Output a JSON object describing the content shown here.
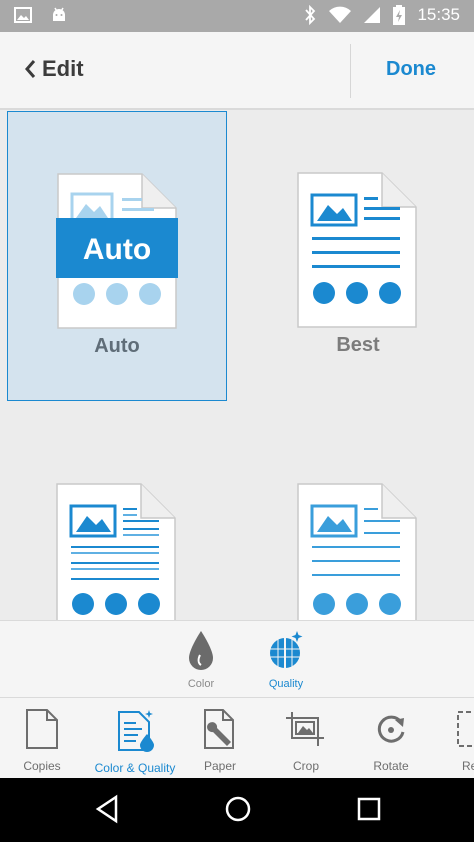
{
  "status_bar": {
    "time": "15:35"
  },
  "app_bar": {
    "back_label": "Edit",
    "done_label": "Done"
  },
  "quality_options": [
    {
      "label": "Auto",
      "badge": "Auto",
      "selected": true
    },
    {
      "label": "Best",
      "selected": false
    },
    {
      "label": "",
      "selected": false
    },
    {
      "label": "",
      "selected": false
    }
  ],
  "mode_tabs": [
    {
      "label": "Color",
      "icon": "droplet-icon",
      "active": false
    },
    {
      "label": "Quality",
      "icon": "quality-icon",
      "active": true
    }
  ],
  "toolbar": {
    "items": [
      {
        "label": "Copies",
        "icon": "copies-icon"
      },
      {
        "label": "Color & Quality",
        "icon": "color-quality-icon",
        "active": true
      },
      {
        "label": "Paper",
        "icon": "paper-icon"
      },
      {
        "label": "Crop",
        "icon": "crop-icon"
      },
      {
        "label": "Rotate",
        "icon": "rotate-icon"
      },
      {
        "label": "Re",
        "icon": "resize-icon"
      }
    ]
  },
  "colors": {
    "accent": "#1b89d0",
    "selected_bg": "#d4e3ee",
    "status_bar": "#a9a9a9"
  }
}
